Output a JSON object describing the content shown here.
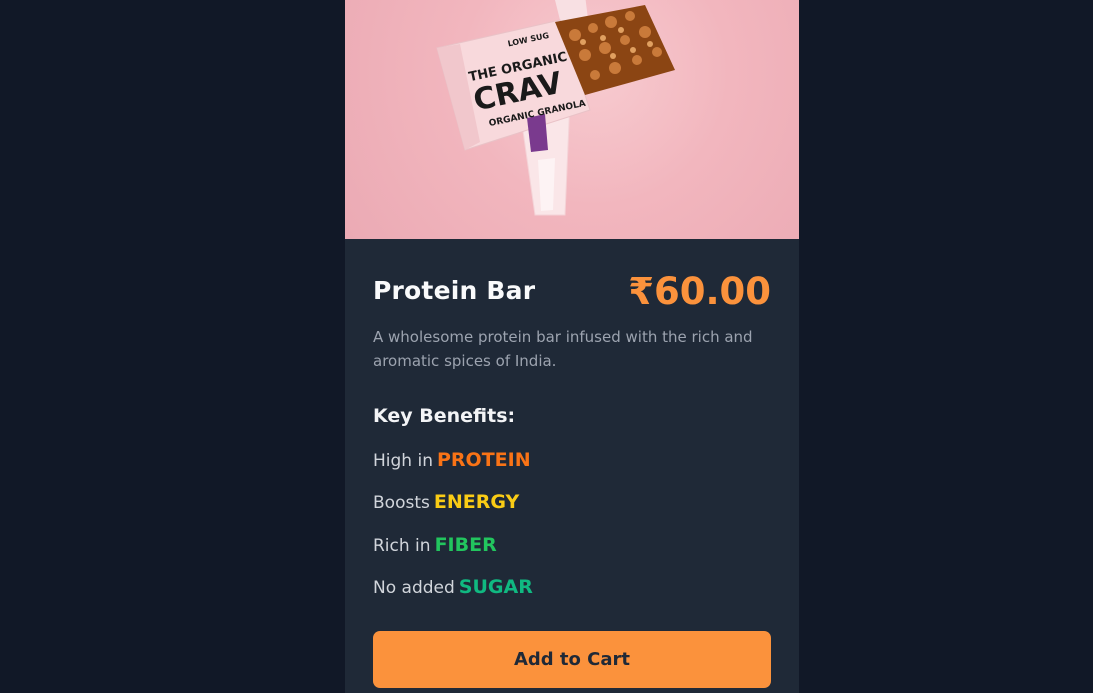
{
  "product": {
    "name": "Protein Bar",
    "price": "₹60.00",
    "description": "A wholesome protein bar infused with the rich and aromatic spices of India.",
    "image_text": {
      "brand_line1": "THE ORGANIC",
      "brand_line2": "CRAV",
      "flavor": "ORGANIC GRANOLA",
      "tag": "LOW SUG"
    }
  },
  "benefits": {
    "heading": "Key Benefits:",
    "items": [
      {
        "prefix": "High in",
        "highlight": "PROTEIN",
        "color": "#f97316"
      },
      {
        "prefix": "Boosts",
        "highlight": "ENERGY",
        "color": "#facc15"
      },
      {
        "prefix": "Rich in",
        "highlight": "FIBER",
        "color": "#22c55e"
      },
      {
        "prefix": "No added",
        "highlight": "SUGAR",
        "color": "#10b981"
      }
    ]
  },
  "actions": {
    "add_to_cart_label": "Add to Cart"
  },
  "colors": {
    "page_background": "#111827",
    "card_background": "#1f2937",
    "accent": "#fb923c"
  }
}
